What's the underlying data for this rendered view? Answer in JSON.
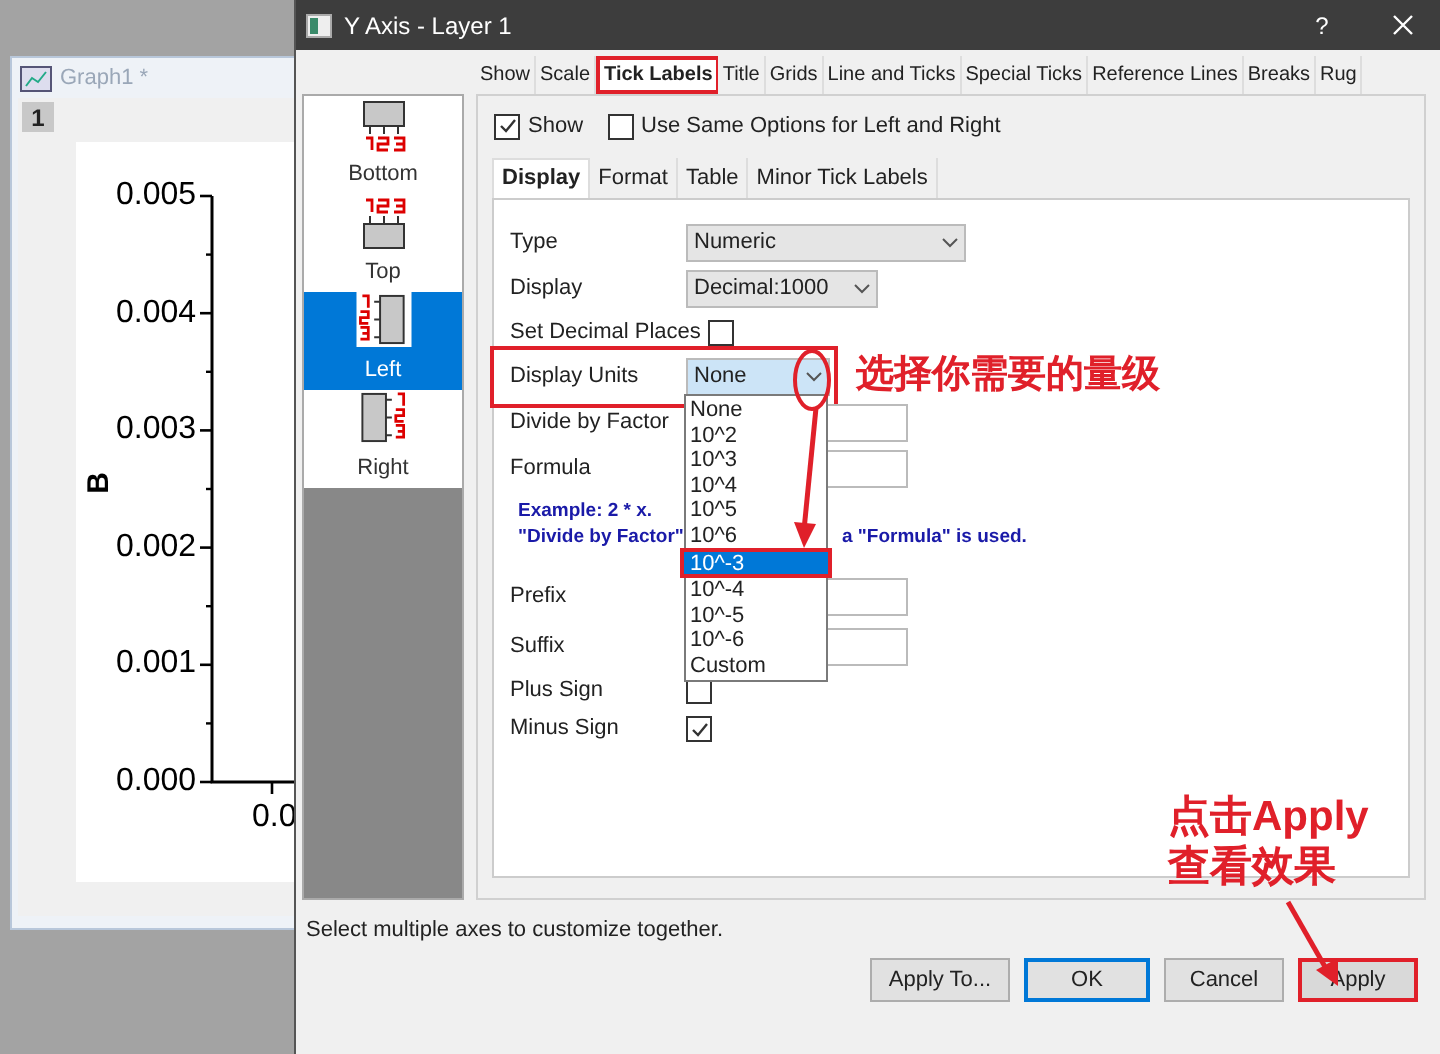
{
  "graph_window": {
    "title": "Graph1 *",
    "layer": "1",
    "y_axis_title": "B",
    "y_tick_labels": [
      "0.005",
      "0.004",
      "0.003",
      "0.002",
      "0.001",
      "0.000"
    ],
    "x_tick_label": "0.0"
  },
  "dialog": {
    "title": "Y Axis - Layer 1",
    "help": "?"
  },
  "tabs": [
    {
      "label": "Show",
      "selected": false
    },
    {
      "label": "Scale",
      "selected": false
    },
    {
      "label": "Tick Labels",
      "selected": true,
      "highlighted": true
    },
    {
      "label": "Title",
      "selected": false
    },
    {
      "label": "Grids",
      "selected": false
    },
    {
      "label": "Line and Ticks",
      "selected": false
    },
    {
      "label": "Special Ticks",
      "selected": false
    },
    {
      "label": "Reference Lines",
      "selected": false
    },
    {
      "label": "Breaks",
      "selected": false
    },
    {
      "label": "Rug",
      "selected": false
    }
  ],
  "axes": [
    {
      "label": "Bottom",
      "kind": "bottom",
      "selected": false
    },
    {
      "label": "Top",
      "kind": "top",
      "selected": false
    },
    {
      "label": "Left",
      "kind": "left",
      "selected": true
    },
    {
      "label": "Right",
      "kind": "right",
      "selected": false
    }
  ],
  "show": {
    "label": "Show",
    "checked": true
  },
  "same_options": {
    "label": "Use Same Options for Left and Right",
    "checked": false
  },
  "subtabs": [
    {
      "label": "Display",
      "selected": true
    },
    {
      "label": "Format",
      "selected": false
    },
    {
      "label": "Table",
      "selected": false
    },
    {
      "label": "Minor Tick Labels",
      "selected": false
    }
  ],
  "fields": [
    {
      "kind": "combo",
      "label": "Type",
      "value": "Numeric"
    },
    {
      "kind": "combo",
      "label": "Display",
      "value": "Decimal:1000"
    },
    {
      "kind": "checkbox",
      "label": "Set Decimal Places",
      "checked": false
    },
    {
      "kind": "combo",
      "label": "Display Units",
      "value": "None",
      "highlighted": true
    },
    {
      "kind": "text",
      "label": "Divide by Factor"
    },
    {
      "kind": "text",
      "label": "Formula"
    },
    {
      "kind": "note",
      "lines": [
        "Example: 2 * x."
      ],
      "parts": [
        "\"Divide by Factor\"",
        "a \"Formula\" is used."
      ]
    },
    {
      "kind": "text",
      "label": "Prefix"
    },
    {
      "kind": "text",
      "label": "Suffix"
    },
    {
      "kind": "checkbox",
      "label": "Plus Sign",
      "checked": false
    },
    {
      "kind": "checkbox",
      "label": "Minus Sign",
      "checked": true
    }
  ],
  "dropdown_options": [
    {
      "label": "None",
      "selected": false
    },
    {
      "label": "10^2",
      "selected": false
    },
    {
      "label": "10^3",
      "selected": false
    },
    {
      "label": "10^4",
      "selected": false
    },
    {
      "label": "10^5",
      "selected": false
    },
    {
      "label": "10^6",
      "selected": false
    },
    {
      "label": "10^-3",
      "selected": true,
      "highlighted": true
    },
    {
      "label": "10^-4",
      "selected": false
    },
    {
      "label": "10^-5",
      "selected": false
    },
    {
      "label": "10^-6",
      "selected": false
    },
    {
      "label": "Custom",
      "selected": false
    }
  ],
  "status_text": "Select multiple axes to customize together.",
  "buttons": [
    {
      "label": "Apply To...",
      "focused": false
    },
    {
      "label": "OK",
      "focused": true
    },
    {
      "label": "Cancel",
      "focused": false
    },
    {
      "label": "Apply",
      "focused": false,
      "highlighted": true
    }
  ],
  "annotations": [
    {
      "text": "选择你需要的量级"
    },
    {
      "text": "点击Apply"
    },
    {
      "text": "查看效果"
    }
  ]
}
